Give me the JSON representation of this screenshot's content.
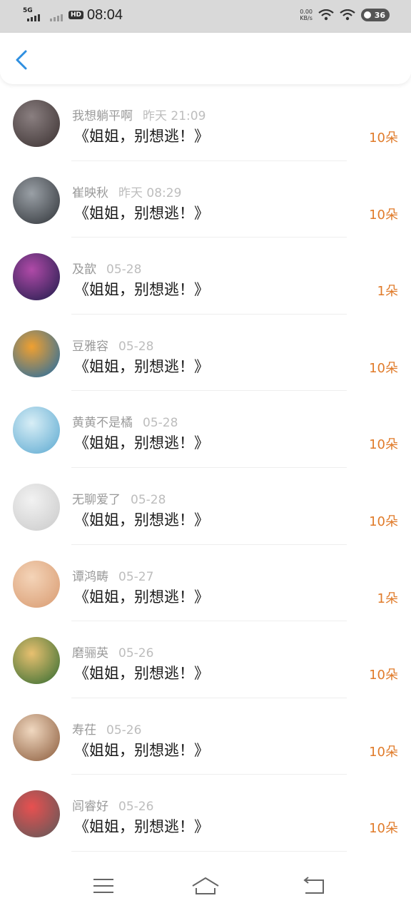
{
  "status_bar": {
    "network": "5G",
    "hd": "HD",
    "time": "08:04",
    "speed_value": "0.00",
    "speed_unit": "KB/s",
    "battery": "36"
  },
  "header": {
    "back_icon": "chevron-left-icon"
  },
  "items": [
    {
      "name": "我想躺平啊",
      "date": "昨天 21:09",
      "title": "《姐姐，别想逃！》",
      "amount": "10朵",
      "avatar_colors": [
        "#8a7f80",
        "#3a3030"
      ]
    },
    {
      "name": "崔映秋",
      "date": "昨天 08:29",
      "title": "《姐姐，别想逃！》",
      "amount": "10朵",
      "avatar_colors": [
        "#9aa0a6",
        "#2f3338"
      ]
    },
    {
      "name": "及歆",
      "date": "05-28",
      "title": "《姐姐，别想逃！》",
      "amount": "1朵",
      "avatar_colors": [
        "#b04aa8",
        "#1d1c4a"
      ]
    },
    {
      "name": "豆雅容",
      "date": "05-28",
      "title": "《姐姐，别想逃！》",
      "amount": "10朵",
      "avatar_colors": [
        "#f0a030",
        "#1a6aa8"
      ]
    },
    {
      "name": "黄黄不是橘",
      "date": "05-28",
      "title": "《姐姐，别想逃！》",
      "amount": "10朵",
      "avatar_colors": [
        "#d8eef6",
        "#5aa8d0"
      ]
    },
    {
      "name": "无聊爱了",
      "date": "05-28",
      "title": "《姐姐，别想逃！》",
      "amount": "10朵",
      "avatar_colors": [
        "#f2f2f2",
        "#c9c9c9"
      ]
    },
    {
      "name": "谭鸿畴",
      "date": "05-27",
      "title": "《姐姐，别想逃！》",
      "amount": "1朵",
      "avatar_colors": [
        "#f4d4b8",
        "#d89a70"
      ]
    },
    {
      "name": "磨骊英",
      "date": "05-26",
      "title": "《姐姐，别想逃！》",
      "amount": "10朵",
      "avatar_colors": [
        "#e8c070",
        "#2f6a30"
      ]
    },
    {
      "name": "寿茌",
      "date": "05-26",
      "title": "《姐姐，别想逃！》",
      "amount": "10朵",
      "avatar_colors": [
        "#f0d8c0",
        "#8a5a3a"
      ]
    },
    {
      "name": "闾睿好",
      "date": "05-26",
      "title": "《姐姐，别想逃！》",
      "amount": "10朵",
      "avatar_colors": [
        "#e85050",
        "#5a5a5a"
      ]
    }
  ],
  "nav_bar": {
    "menu_icon": "menu-icon",
    "home_icon": "home-icon",
    "back_icon": "back-arrow-icon"
  },
  "colors": {
    "accent": "#e07b2a",
    "back": "#2f8fe0",
    "status_bar_bg": "#d9d9d9"
  }
}
